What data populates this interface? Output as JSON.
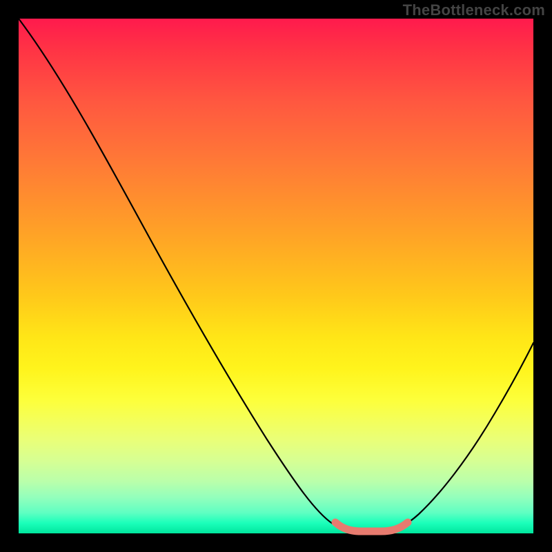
{
  "watermark": "TheBottleneck.com",
  "chart_data": {
    "type": "line",
    "title": "",
    "xlabel": "",
    "ylabel": "",
    "xlim": [
      0,
      100
    ],
    "ylim": [
      0,
      100
    ],
    "grid": false,
    "series": [
      {
        "name": "bottleneck-curve",
        "x": [
          0,
          10,
          20,
          30,
          40,
          50,
          58,
          62,
          66,
          70,
          74,
          80,
          86,
          92,
          100
        ],
        "values": [
          100,
          85,
          70,
          55,
          40,
          25,
          12,
          4,
          0,
          0,
          3,
          10,
          20,
          32,
          50
        ]
      }
    ],
    "annotations": [
      {
        "name": "minimum-marker",
        "x_start": 62,
        "x_end": 72,
        "y": 0,
        "color": "#e77b6f"
      }
    ]
  },
  "colors": {
    "curve": "#000000",
    "marker": "#e77b6f",
    "border": "#000000",
    "watermark": "#444444"
  }
}
